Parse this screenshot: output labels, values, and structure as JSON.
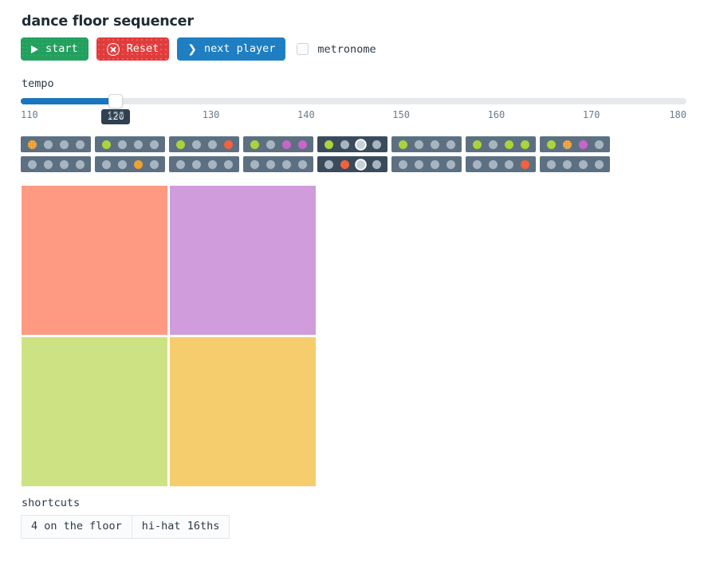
{
  "app": {
    "title": "dance floor sequencer"
  },
  "toolbar": {
    "start_label": "start",
    "start_icon": "play-triangle-icon",
    "start_color": "#23a05e",
    "reset_label": "Reset",
    "reset_icon": "x-circle-icon",
    "reset_color": "#e13b3b",
    "next_label": "next player",
    "next_icon": "chevron-right-icon",
    "next_color": "#1d7ec1",
    "metronome_label": "metronome",
    "metronome_checked": false
  },
  "tempo": {
    "label": "tempo",
    "value": 120,
    "value_text": "120",
    "min": 110,
    "max": 180,
    "ticks": [
      "110",
      "120",
      "130",
      "140",
      "150",
      "160",
      "170",
      "180"
    ],
    "tick_values": [
      110,
      120,
      130,
      140,
      150,
      160,
      170,
      180
    ],
    "fill_color": "#1b77bd",
    "track_color": "#e6e9ec"
  },
  "sequencer": {
    "groups_count": 8,
    "steps_per_group": 4,
    "rows": 2,
    "active_group_index": 4,
    "playhead_step_index": 2,
    "colors": {
      "empty": "#a7b5c0",
      "green": "#a9d43a",
      "orange": "#eea030",
      "red": "#f4613d",
      "purple": "#c766c8",
      "group_bg": "#5d7082",
      "group_bg_active": "#3a4b5c"
    },
    "groups": [
      {
        "active": false,
        "row_top": [
          "orange-textured",
          "empty",
          "empty",
          "empty"
        ],
        "row_bottom": [
          "empty",
          "empty",
          "empty",
          "empty"
        ]
      },
      {
        "active": false,
        "row_top": [
          "green",
          "empty",
          "empty",
          "empty"
        ],
        "row_bottom": [
          "empty",
          "empty",
          "orange",
          "empty"
        ]
      },
      {
        "active": false,
        "row_top": [
          "green",
          "empty",
          "empty",
          "red"
        ],
        "row_bottom": [
          "empty",
          "empty",
          "empty",
          "empty"
        ]
      },
      {
        "active": false,
        "row_top": [
          "green",
          "empty",
          "purple",
          "purple"
        ],
        "row_bottom": [
          "empty",
          "empty",
          "empty",
          "empty"
        ]
      },
      {
        "active": true,
        "row_top": [
          "green",
          "empty",
          "playhead",
          "empty"
        ],
        "row_bottom": [
          "empty",
          "red",
          "playhead",
          "empty"
        ]
      },
      {
        "active": false,
        "row_top": [
          "green",
          "empty",
          "empty",
          "empty"
        ],
        "row_bottom": [
          "empty",
          "empty",
          "empty",
          "empty"
        ]
      },
      {
        "active": false,
        "row_top": [
          "green",
          "empty",
          "green",
          "green"
        ],
        "row_bottom": [
          "empty",
          "empty",
          "empty",
          "red"
        ]
      },
      {
        "active": false,
        "row_top": [
          "green",
          "orange-textured",
          "purple",
          "empty"
        ],
        "row_bottom": [
          "empty",
          "empty",
          "empty",
          "empty"
        ]
      }
    ]
  },
  "pads": [
    {
      "name": "pad-salmon",
      "color": "#ff9a82"
    },
    {
      "name": "pad-orchid",
      "color": "#d09cdb"
    },
    {
      "name": "pad-lime",
      "color": "#cde383"
    },
    {
      "name": "pad-amber",
      "color": "#f5cd6d"
    }
  ],
  "shortcuts": {
    "label": "shortcuts",
    "buttons": [
      "4 on the floor",
      "hi-hat 16ths"
    ]
  }
}
